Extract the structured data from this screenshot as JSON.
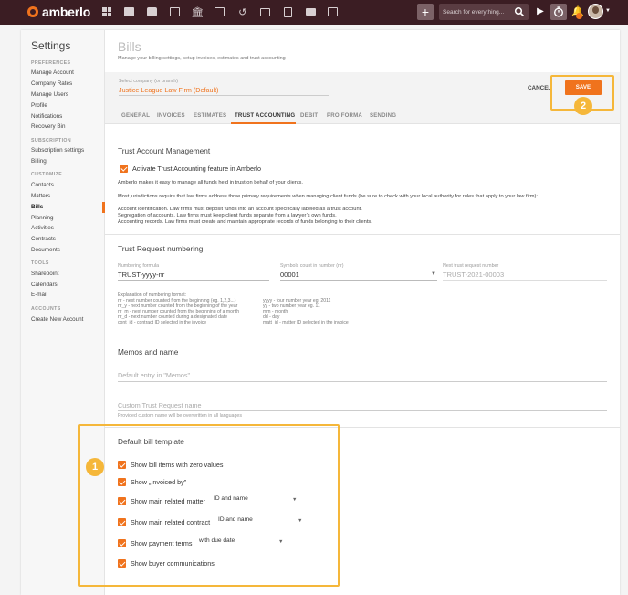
{
  "topbar": {
    "logo_text": "amberlo",
    "nav_icons": [
      "dashboard-icon",
      "contacts-icon",
      "matters-icon",
      "documents-icon",
      "billing-icon",
      "calendar-icon",
      "history-icon",
      "folder-icon",
      "file-icon",
      "mail-icon",
      "reports-icon"
    ],
    "search_placeholder": "Search for everything...",
    "add_label": "+",
    "accent": "#f0731d",
    "bar_color": "#3b1d23"
  },
  "sidebar": {
    "title": "Settings",
    "sections": [
      {
        "label": "PREFERENCES",
        "items": [
          "Manage Account",
          "Company Rates",
          "Manage Users",
          "Profile",
          "Notifications",
          "Recovery Bin"
        ]
      },
      {
        "label": "SUBSCRIPTION",
        "items": [
          "Subscription settings",
          "Billing"
        ]
      },
      {
        "label": "CUSTOMIZE",
        "items": [
          "Contacts",
          "Matters",
          "Bills",
          "Planning",
          "Activities",
          "Contracts",
          "Documents"
        ]
      },
      {
        "label": "TOOLS",
        "items": [
          "Sharepoint",
          "Calendars",
          "E-mail"
        ]
      },
      {
        "label": "ACCOUNTS",
        "items": [
          "Create New Account"
        ]
      }
    ],
    "active_item": "Bills"
  },
  "page": {
    "title": "Bills",
    "subtitle": "Manage your billing settings, setup invoices, estimates and trust accounting",
    "company_label": "Select company (or branch)",
    "company_value": "Justice League Law Firm (Default)",
    "cancel_label": "CANCEL",
    "save_label": "SAVE",
    "tabs": [
      "GENERAL",
      "INVOICES",
      "ESTIMATES",
      "TRUST ACCOUNTING",
      "DEBIT",
      "PRO FORMA",
      "SENDING"
    ],
    "active_tab": "TRUST ACCOUNTING"
  },
  "trust_mgmt": {
    "title": "Trust Account Management",
    "activate_label": "Activate Trust Accounting feature in Amberlo",
    "activate_checked": true,
    "para1": "Amberlo makes it easy to manage all funds held in trust on behalf of your clients.",
    "para2": "Most jurisdictions require that law firms address three primary requirements when managing client funds (be sure to check with your local authority for rules that apply to your law firm):",
    "req1": "Account identification. Law firms must deposit funds into an account specifically labeled as a trust account.",
    "req2": "Segregation of accounts. Law firms must keep client funds separate from a lawyer’s own funds.",
    "req3": "Accounting records. Law firms must create and maintain appropriate records of funds belonging to their clients."
  },
  "trust_numbering": {
    "title": "Trust Request numbering",
    "formula_label": "Numbering formula",
    "formula_value": "TRUST-yyyy-nr",
    "symbols_label": "Symbols count in number (nr)",
    "symbols_value": "00001",
    "next_label": "Next trust request number",
    "next_value": "TRUST-2021-00003",
    "explain_header": "Explanation of numbering format:",
    "explain_left": [
      "nr - next number counted from the beginning (eg. 1,2,3...)",
      "nr_y - next number counted from the beginning of the year",
      "nr_m - next number counted from the beginning of a month",
      "nr_d - next number counted during a designated date",
      "cont_id - contract ID selected in the invoice"
    ],
    "explain_right": [
      "yyyy - four number year eg. 2011",
      "yy - two number year eg. 11",
      "mm - month",
      "dd - day",
      "matt_id - matter ID selected in the invoice"
    ]
  },
  "memos": {
    "title": "Memos and name",
    "memo_placeholder": "Default entry in \"Memos\"",
    "custom_placeholder": "Custom Trust Request name",
    "custom_hint": "Provided custom name will be overwritten in all languages"
  },
  "bill_template": {
    "title": "Default bill template",
    "options": [
      {
        "label": "Show bill items with zero values",
        "checked": true
      },
      {
        "label": "Show „Invoiced by”",
        "checked": true
      },
      {
        "label": "Show main related matter",
        "checked": true,
        "select": "ID and name"
      },
      {
        "label": "Show main related contract",
        "checked": true,
        "select": "ID and name"
      },
      {
        "label": "Show payment terms",
        "checked": true,
        "select": "with due date"
      },
      {
        "label": "Show buyer communications",
        "checked": true
      }
    ]
  },
  "callouts": {
    "badge1": "1",
    "badge2": "2",
    "highlight_color": "#f5b73a"
  }
}
